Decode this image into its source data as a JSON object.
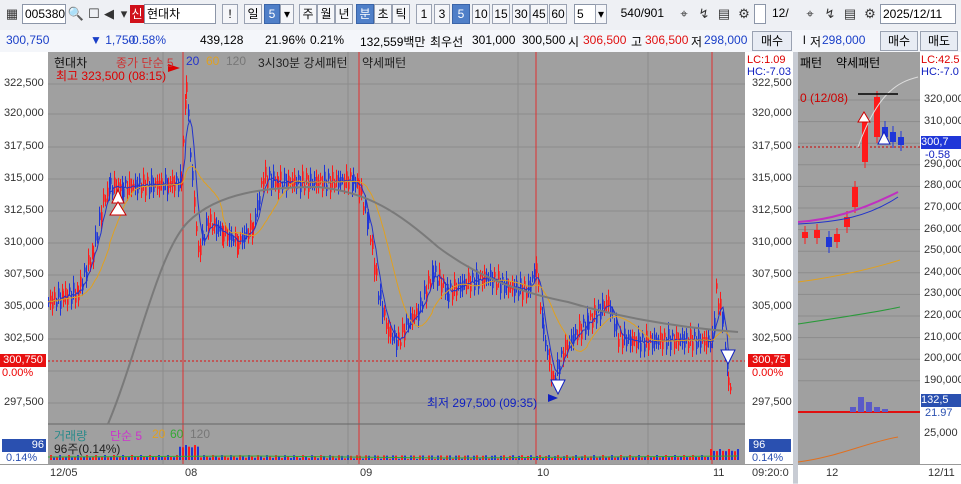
{
  "toolbar": {
    "code": "005380",
    "badge": "신",
    "name": "현대차",
    "excl": "!",
    "period_day": "일",
    "period_num": "5",
    "week": "주",
    "month": "월",
    "year": "년",
    "minute": "분",
    "second": "초",
    "tick": "틱",
    "nums": [
      "1",
      "3",
      "5",
      "10",
      "15",
      "30",
      "45",
      "60"
    ],
    "count": "5",
    "pages": "540/901",
    "right_num": "12/",
    "date": "2025/12/11"
  },
  "quote": {
    "price": "300,750",
    "change": "1,750",
    "pct": "-0.58%",
    "volume": "439,128",
    "vol_pct": "21.96%",
    "ratio": "0.21%",
    "amount": "132,559백만",
    "best_label": "최우선",
    "bid": "301,000",
    "ask": "300,500",
    "open_label": "시",
    "open": "306,500",
    "high_label": "고",
    "high": "306,500",
    "low_label": "저",
    "low": "298,000",
    "buy_button": "매수",
    "right_low_label": "저",
    "right_low": "298,000",
    "right_buy": "매수",
    "right_sell": "매도"
  },
  "main_chart": {
    "legend_name": "현대차",
    "legend_series": "종가 단순 5",
    "ma_20": "20",
    "ma_60": "60",
    "ma_120": "120",
    "pattern_strong": "3시30분 강세패턴",
    "pattern_weak": "약세패턴",
    "high_note": "최고 323,500 (08:15)",
    "low_note": "최저 297,500 (09:35)",
    "current_tag": "300,750",
    "current_pct": "0.00%",
    "right_tag": "300,75",
    "right_pct": "0.00%",
    "lc": "LC:1.09",
    "hc": "HC:-7.03",
    "y_ticks": [
      "322,500",
      "320,000",
      "317,500",
      "315,000",
      "312,500",
      "310,000",
      "307,500",
      "305,000",
      "302,500",
      "297,500"
    ],
    "y_ticks_left": [
      "322,500",
      "320,000",
      "317,500",
      "315,000",
      "312,500",
      "310,000",
      "307,500",
      "305,000",
      "302,500",
      "297,500"
    ],
    "vol_legend": "거래량",
    "vol_series": "단순 5",
    "vol_ma": [
      "20",
      "60",
      "120"
    ],
    "vol_value": "96주(0.14%)",
    "vol_tag": "96",
    "vol_pct": "0.14%",
    "x_labels": [
      "12/05",
      "08",
      "09",
      "10",
      "11"
    ],
    "x_time": "09:20:0"
  },
  "side_chart": {
    "pattern1": "패턴",
    "pattern2": "약세패턴",
    "lc": "LC:42.5",
    "hc": "HC:-7.0",
    "note": "0 (12/08)",
    "y_ticks": [
      "320,000",
      "310,000",
      "300,000",
      "290,000",
      "280,000",
      "270,000",
      "260,000",
      "250,000",
      "240,000",
      "230,000",
      "220,000",
      "210,000",
      "200,000",
      "190,000"
    ],
    "price_tag": "300,7",
    "price_pct": "-0.58",
    "vol_tag": "132,5",
    "vol_pct": "21.97",
    "vol_tick": "25,000",
    "x_label": "12",
    "x_right": "12/11"
  },
  "colors": {
    "up": "#ff1a1a",
    "down": "#1f36d8",
    "ma5": "#2233cc",
    "ma20": "#e0a020",
    "ma60": "#7a7a7a",
    "bg": "#a0a0a0"
  }
}
